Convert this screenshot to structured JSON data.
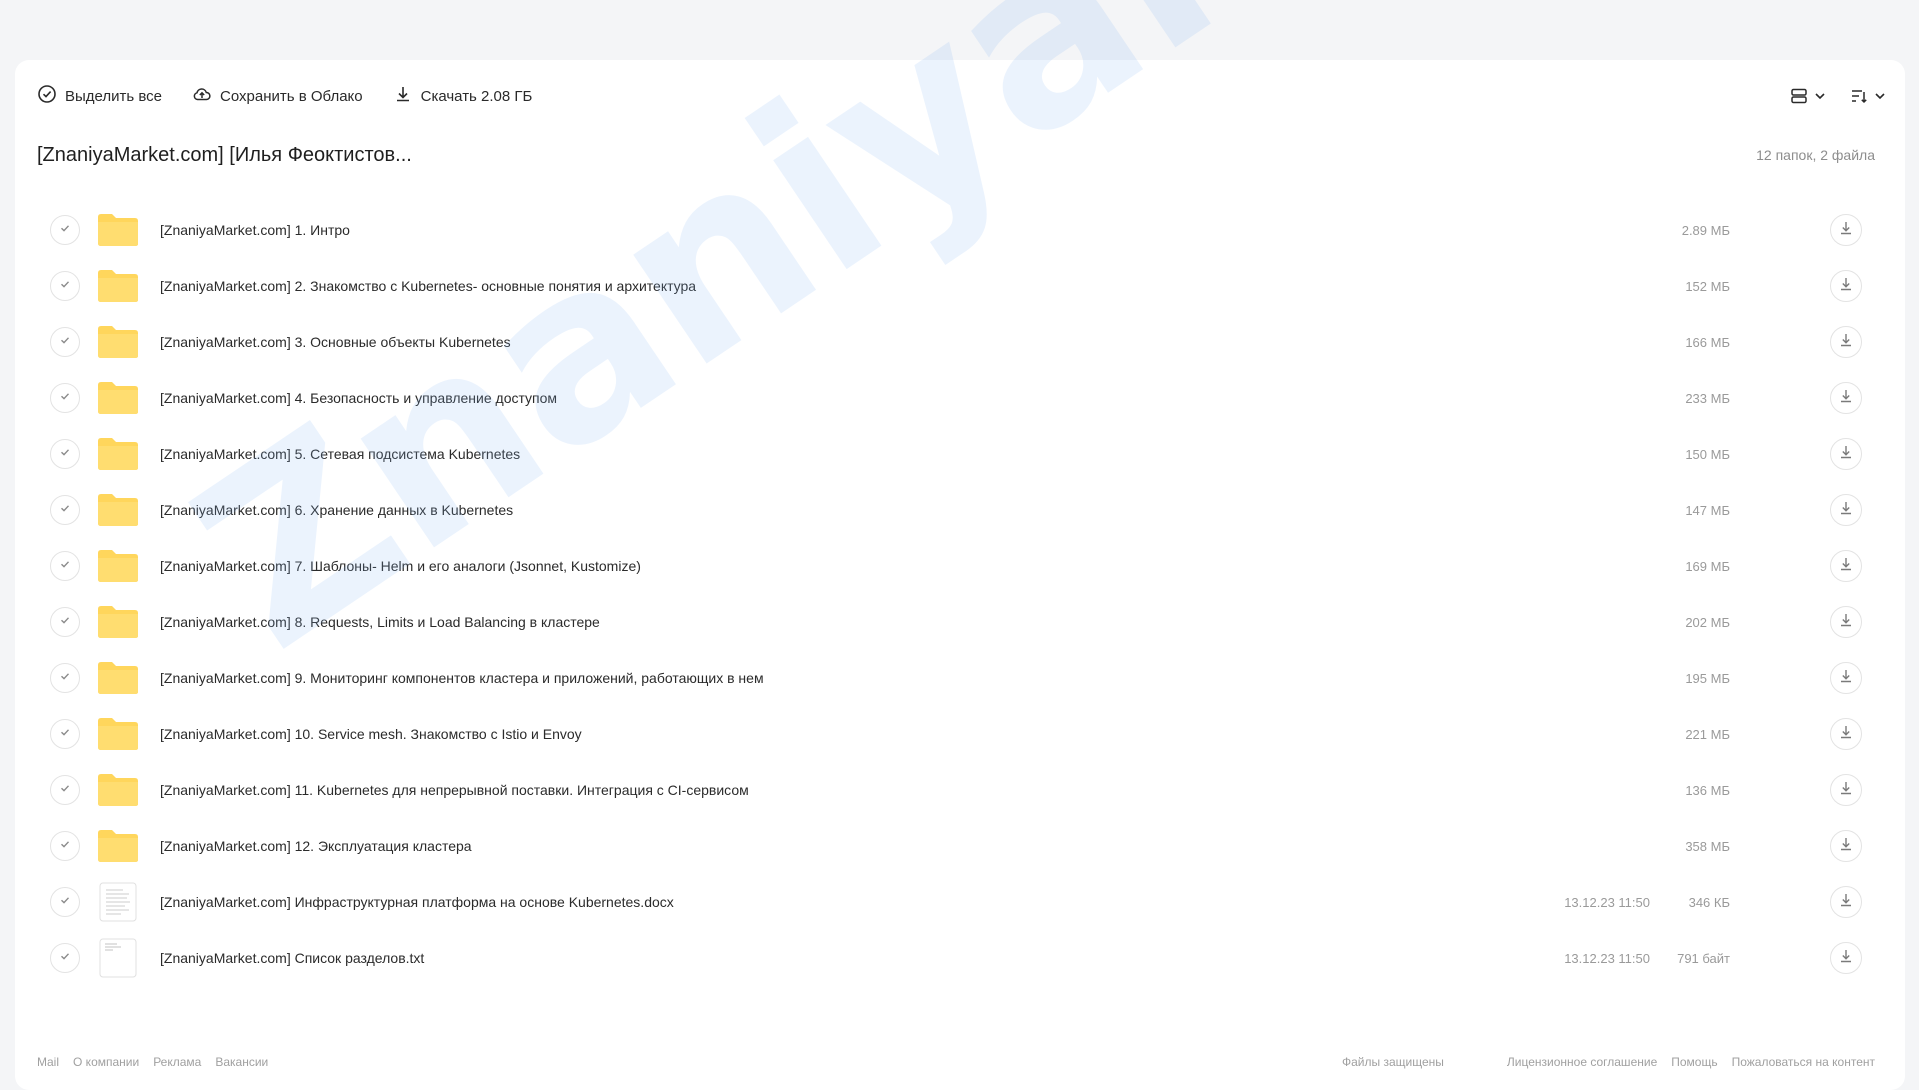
{
  "toolbar": {
    "select_all": "Выделить все",
    "save_cloud": "Сохранить в Облако",
    "download": "Скачать 2.08 ГБ"
  },
  "header": {
    "title": "[ZnaniyaMarket.com] [Илья Феоктистов...",
    "summary": "12 папок, 2 файла"
  },
  "items": [
    {
      "name": "[ZnaniyaMarket.com] 1. Интро",
      "date": "",
      "size": "2.89 МБ",
      "type": "folder"
    },
    {
      "name": "[ZnaniyaMarket.com] 2. Знакомство с Kubernetes- основные понятия и архитектура",
      "date": "",
      "size": "152 МБ",
      "type": "folder"
    },
    {
      "name": "[ZnaniyaMarket.com] 3. Основные объекты Kubernetes",
      "date": "",
      "size": "166 МБ",
      "type": "folder"
    },
    {
      "name": "[ZnaniyaMarket.com] 4. Безопасность и управление доступом",
      "date": "",
      "size": "233 МБ",
      "type": "folder"
    },
    {
      "name": "[ZnaniyaMarket.com] 5. Сетевая подсистема Kubernetes",
      "date": "",
      "size": "150 МБ",
      "type": "folder"
    },
    {
      "name": "[ZnaniyaMarket.com] 6. Хранение данных в Kubernetes",
      "date": "",
      "size": "147 МБ",
      "type": "folder"
    },
    {
      "name": "[ZnaniyaMarket.com] 7. Шаблоны- Helm и его аналоги (Jsonnet, Kustomize)",
      "date": "",
      "size": "169 МБ",
      "type": "folder"
    },
    {
      "name": "[ZnaniyaMarket.com] 8. Requests, Limits и Load Balancing в кластере",
      "date": "",
      "size": "202 МБ",
      "type": "folder"
    },
    {
      "name": "[ZnaniyaMarket.com] 9. Мониторинг компонентов кластера и приложений, работающих в нем",
      "date": "",
      "size": "195 МБ",
      "type": "folder"
    },
    {
      "name": "[ZnaniyaMarket.com] 10. Service mesh. Знакомство с Istio и Envoy",
      "date": "",
      "size": "221 МБ",
      "type": "folder"
    },
    {
      "name": "[ZnaniyaMarket.com] 11. Kubernetes для непрерывной поставки. Интеграция с CI-сервисом",
      "date": "",
      "size": "136 МБ",
      "type": "folder"
    },
    {
      "name": "[ZnaniyaMarket.com] 12. Эксплуатация кластера",
      "date": "",
      "size": "358 МБ",
      "type": "folder"
    },
    {
      "name": "[ZnaniyaMarket.com] Инфраструктурная платформа на основе Kubernetes.docx",
      "date": "13.12.23 11:50",
      "size": "346 КБ",
      "type": "docx"
    },
    {
      "name": "[ZnaniyaMarket.com] Список разделов.txt",
      "date": "13.12.23 11:50",
      "size": "791 байт",
      "type": "txt"
    }
  ],
  "footer": {
    "left": [
      "Mail",
      "О компании",
      "Реклама",
      "Вакансии"
    ],
    "middle": "Файлы защищены",
    "right": [
      "Лицензионное соглашение",
      "Помощь",
      "Пожаловаться на контент"
    ]
  },
  "watermark": "ZnaniyaMarket.club",
  "colors": {
    "folder": "#ffd65c",
    "background": "#f4f5f7",
    "muted_text": "#9a9a9a",
    "watermark": "#82b4f5"
  }
}
